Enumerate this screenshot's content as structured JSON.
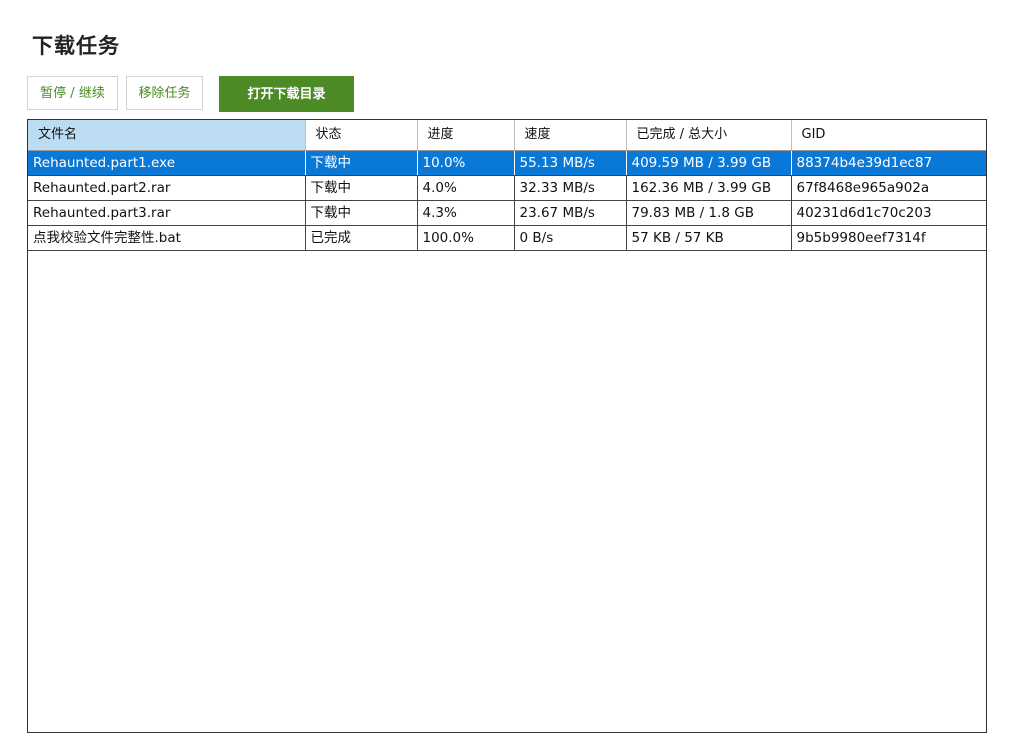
{
  "title": "下载任务",
  "toolbar": {
    "pause_resume_label": "暂停 / 继续",
    "remove_label": "移除任务",
    "open_folder_label": "打开下载目录"
  },
  "table": {
    "columns": [
      "文件名",
      "状态",
      "进度",
      "速度",
      "已完成 / 总大小",
      "GID"
    ],
    "sorted_column": "文件名",
    "selected_row": 0,
    "rows": [
      [
        "Rehaunted.part1.exe",
        "下载中",
        "10.0%",
        "55.13 MB/s",
        "409.59 MB / 3.99 GB",
        "88374b4e39d1ec87"
      ],
      [
        "Rehaunted.part2.rar",
        "下载中",
        "4.0%",
        "32.33 MB/s",
        "162.36 MB / 3.99 GB",
        "67f8468e965a902a"
      ],
      [
        "Rehaunted.part3.rar",
        "下载中",
        "4.3%",
        "23.67 MB/s",
        "79.83 MB / 1.8 GB",
        "40231d6d1c70c203"
      ],
      [
        "点我校验文件完整性.bat",
        "已完成",
        "100.0%",
        "0 B/s",
        "57 KB / 57 KB",
        "9b5b9980eef7314f"
      ]
    ]
  },
  "colors": {
    "accent_green": "#4c8a25",
    "selection_blue": "#0a78d7",
    "sorted_header": "#bcdcf2"
  }
}
